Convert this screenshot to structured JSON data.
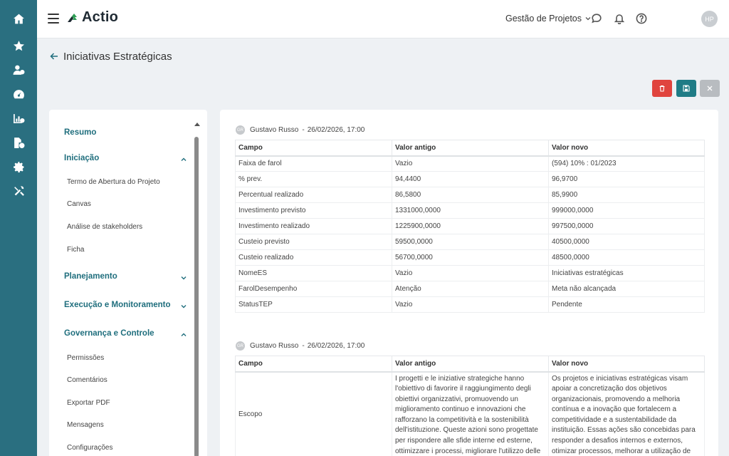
{
  "app": {
    "logo_text": "Actio",
    "project_selector": "Gestão de Projetos",
    "avatar_initials": "HP"
  },
  "colors": {
    "rail": "#2a6f80",
    "accent": "#1f6e7d",
    "delete": "#e0443e",
    "save": "#1f7c86",
    "close": "#b8bcc0"
  },
  "rail_icons": [
    "home-icon",
    "star-icon",
    "users-icon",
    "dashboard-icon",
    "chart-icon",
    "document-money-icon",
    "gear-icon",
    "tools-icon"
  ],
  "page": {
    "title": "Iniciativas Estratégicas"
  },
  "sidebar": {
    "sections": [
      {
        "label": "Resumo"
      },
      {
        "label": "Iniciação",
        "items": [
          "Termo de Abertura do Projeto",
          "Canvas",
          "Análise de stakeholders",
          "Ficha"
        ]
      },
      {
        "label": "Planejamento"
      },
      {
        "label": "Execução e Monitoramento"
      },
      {
        "label": "Governança e Controle",
        "items": [
          "Permissões",
          "Comentários",
          "Exportar PDF",
          "Mensagens",
          "Configurações"
        ]
      }
    ]
  },
  "history": {
    "columns": [
      "Campo",
      "Valor antigo",
      "Valor novo"
    ],
    "entries": [
      {
        "user": "Gustavo Russo",
        "date": "26/02/2026, 17:00",
        "rows": [
          [
            "Faixa de farol",
            "Vazio",
            "(594) 10% : 01/2023"
          ],
          [
            "% prev.",
            "94,4400",
            "96,9700"
          ],
          [
            "Percentual realizado",
            "86,5800",
            "85,9900"
          ],
          [
            "Investimento previsto",
            "1331000,0000",
            "999000,0000"
          ],
          [
            "Investimento realizado",
            "1225900,0000",
            "997500,0000"
          ],
          [
            "Custeio previsto",
            "59500,0000",
            "40500,0000"
          ],
          [
            "Custeio realizado",
            "56700,0000",
            "48500,0000"
          ],
          [
            "NomeES",
            "Vazio",
            "Iniciativas estratégicas"
          ],
          [
            "FarolDesempenho",
            "Atenção",
            "Meta não alcançada"
          ],
          [
            "StatusTEP",
            "Vazio",
            "Pendente"
          ]
        ]
      },
      {
        "user": "Gustavo Russo",
        "date": "26/02/2026, 17:00",
        "rows": [
          [
            "Escopo",
            "I progetti e le iniziative strategiche hanno l'obiettivo di favorire il raggiungimento degli obiettivi organizzativi, promuovendo un miglioramento continuo e innovazioni che rafforzano la competitività e la sostenibilità dell'istituzione. Queste azioni sono progettate per rispondere alle sfide interne ed esterne, ottimizzare i processi, migliorare l'utilizzo delle",
            "Os projetos e iniciativas estratégicas visam apoiar a concretização dos objetivos organizacionais, promovendo a melhoria contínua e a inovação que fortalecem a competitividade e a sustentabilidade da instituição. Essas ações são concebidas para responder a desafios internos e externos, otimizar processos, melhorar a utilização de"
          ]
        ]
      }
    ]
  }
}
